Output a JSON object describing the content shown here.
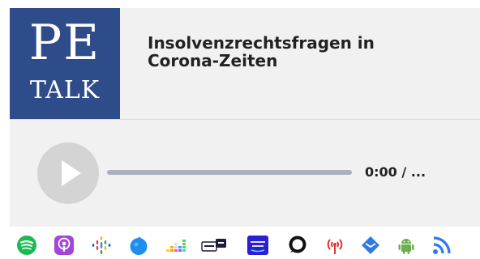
{
  "cover": {
    "line1": "PE",
    "line2": "TALK"
  },
  "episode": {
    "title": "Insolvenzrechtsfragen in Corona-Zeiten"
  },
  "player": {
    "time": "0:00 / ..."
  },
  "subscribe_icons": [
    "spotify-icon",
    "apple-podcasts-icon",
    "google-podcasts-icon",
    "castbox-icon",
    "deezer-icon",
    "tunein-icon",
    "amazon-music-icon",
    "podcast-addict-icon",
    "podcast-antenna-icon",
    "email-icon",
    "android-icon",
    "rss-icon"
  ],
  "colors": {
    "cover_bg": "#2f4c8a",
    "accent": "#aab1bb"
  }
}
